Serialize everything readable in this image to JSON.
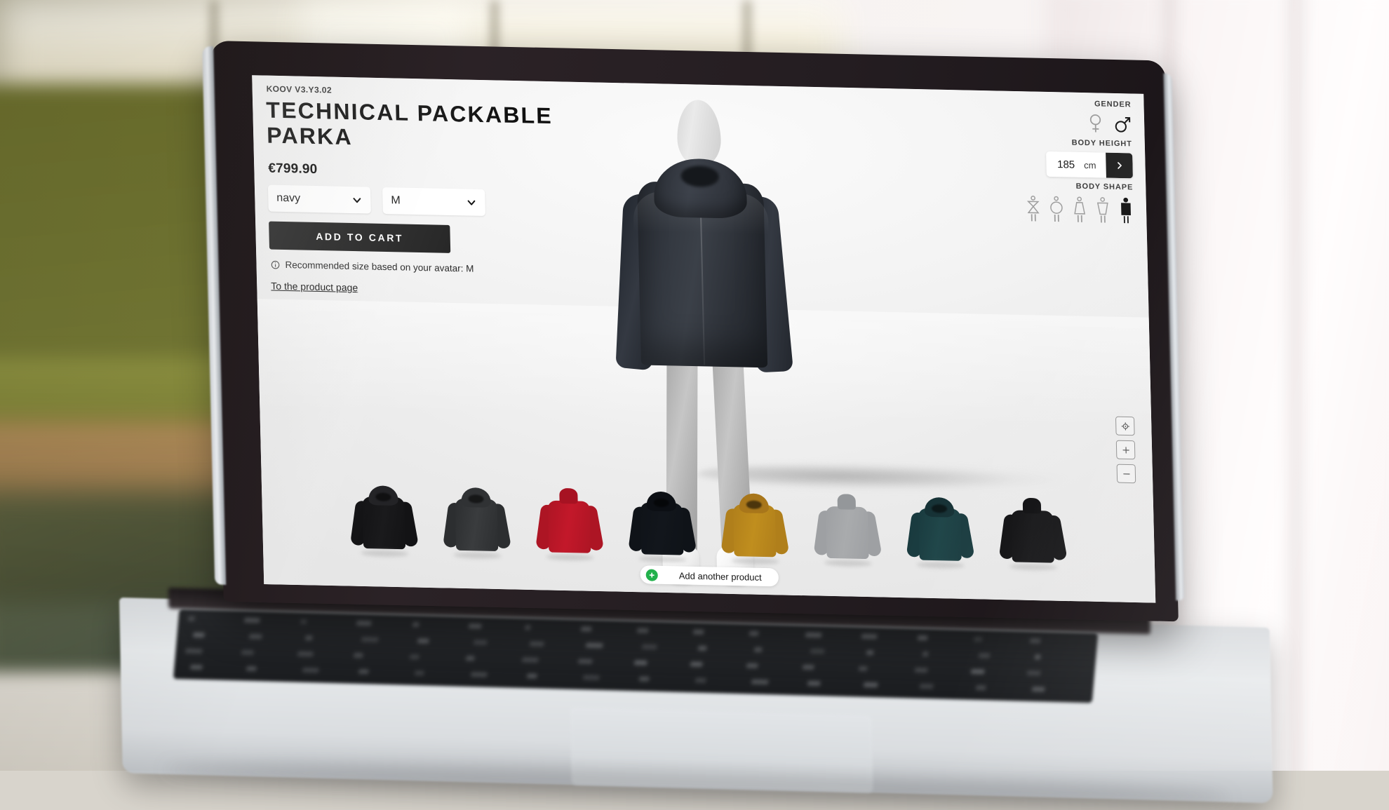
{
  "app": {
    "brand_version": "KOOV V3.Y3.02",
    "product_title": "TECHNICAL PACKABLE PARKA",
    "price": "€799.90",
    "color_select": {
      "value": "navy",
      "icon": "chevron-down-icon"
    },
    "size_select": {
      "value": "M",
      "icon": "chevron-down-icon"
    },
    "add_to_cart_label": "ADD TO CART",
    "recommendation": "Recommended size based on your avatar: M",
    "recommendation_icon": "info-icon",
    "product_page_link": "To the product page"
  },
  "controls": {
    "gender": {
      "label": "GENDER",
      "options": [
        {
          "name": "female",
          "icon": "venus-icon",
          "selected": false
        },
        {
          "name": "male",
          "icon": "mars-icon",
          "selected": true
        }
      ]
    },
    "body_height": {
      "label": "BODY HEIGHT",
      "value": "185",
      "unit": "cm",
      "next_icon": "chevron-right-icon"
    },
    "body_shape": {
      "label": "BODY SHAPE",
      "options": [
        {
          "name": "hourglass",
          "selected": false
        },
        {
          "name": "round",
          "selected": false
        },
        {
          "name": "triangle",
          "selected": false
        },
        {
          "name": "inverted-triangle",
          "selected": false
        },
        {
          "name": "rectangle",
          "selected": true
        }
      ]
    }
  },
  "viewer": {
    "buttons": [
      {
        "name": "recenter",
        "icon": "target-icon",
        "label": ""
      },
      {
        "name": "zoom-in",
        "icon": "plus-icon",
        "label": "+"
      },
      {
        "name": "zoom-out",
        "icon": "minus-icon",
        "label": "−"
      }
    ]
  },
  "avatar": {
    "garment": "Technical Packable Parka",
    "garment_color": "#2f343c",
    "skin_color": "#c2c2c2",
    "shoe_color": "#ffffff"
  },
  "thumbnails": [
    {
      "name": "black-hooded-parka",
      "body": "#1a1a1c",
      "hood": "#232326",
      "sleeve": "#131315",
      "type": "hooded"
    },
    {
      "name": "charcoal-long-parka",
      "body": "#3a3c3e",
      "hood": "#303234",
      "sleeve": "#2c2e30",
      "type": "hooded"
    },
    {
      "name": "red-longsleeve-top",
      "body": "#c3182a",
      "hood": "#a71222",
      "sleeve": "#ad1524",
      "type": "crew"
    },
    {
      "name": "navy-hooded-jacket",
      "body": "#12161c",
      "hood": "#0c0f14",
      "sleeve": "#0f1318",
      "type": "hooded"
    },
    {
      "name": "mustard-hooded-jacket",
      "body": "#c08e1e",
      "hood": "#a8761a",
      "sleeve": "#b07f1b",
      "type": "hooded"
    },
    {
      "name": "grey-sweater",
      "body": "#a9abad",
      "hood": "#94979a",
      "sleeve": "#9ea0a3",
      "type": "crew"
    },
    {
      "name": "teal-hooded-jacket",
      "body": "#1d4447",
      "hood": "#143034",
      "sleeve": "#183a3e",
      "type": "hooded"
    },
    {
      "name": "black-sweater",
      "body": "#111113",
      "hood": "#0a0a0c",
      "sleeve": "#0d0d0f",
      "type": "crew"
    }
  ],
  "add_product": {
    "label": "Add another product",
    "icon": "plus-circle-icon",
    "accent": "#22b14c"
  }
}
